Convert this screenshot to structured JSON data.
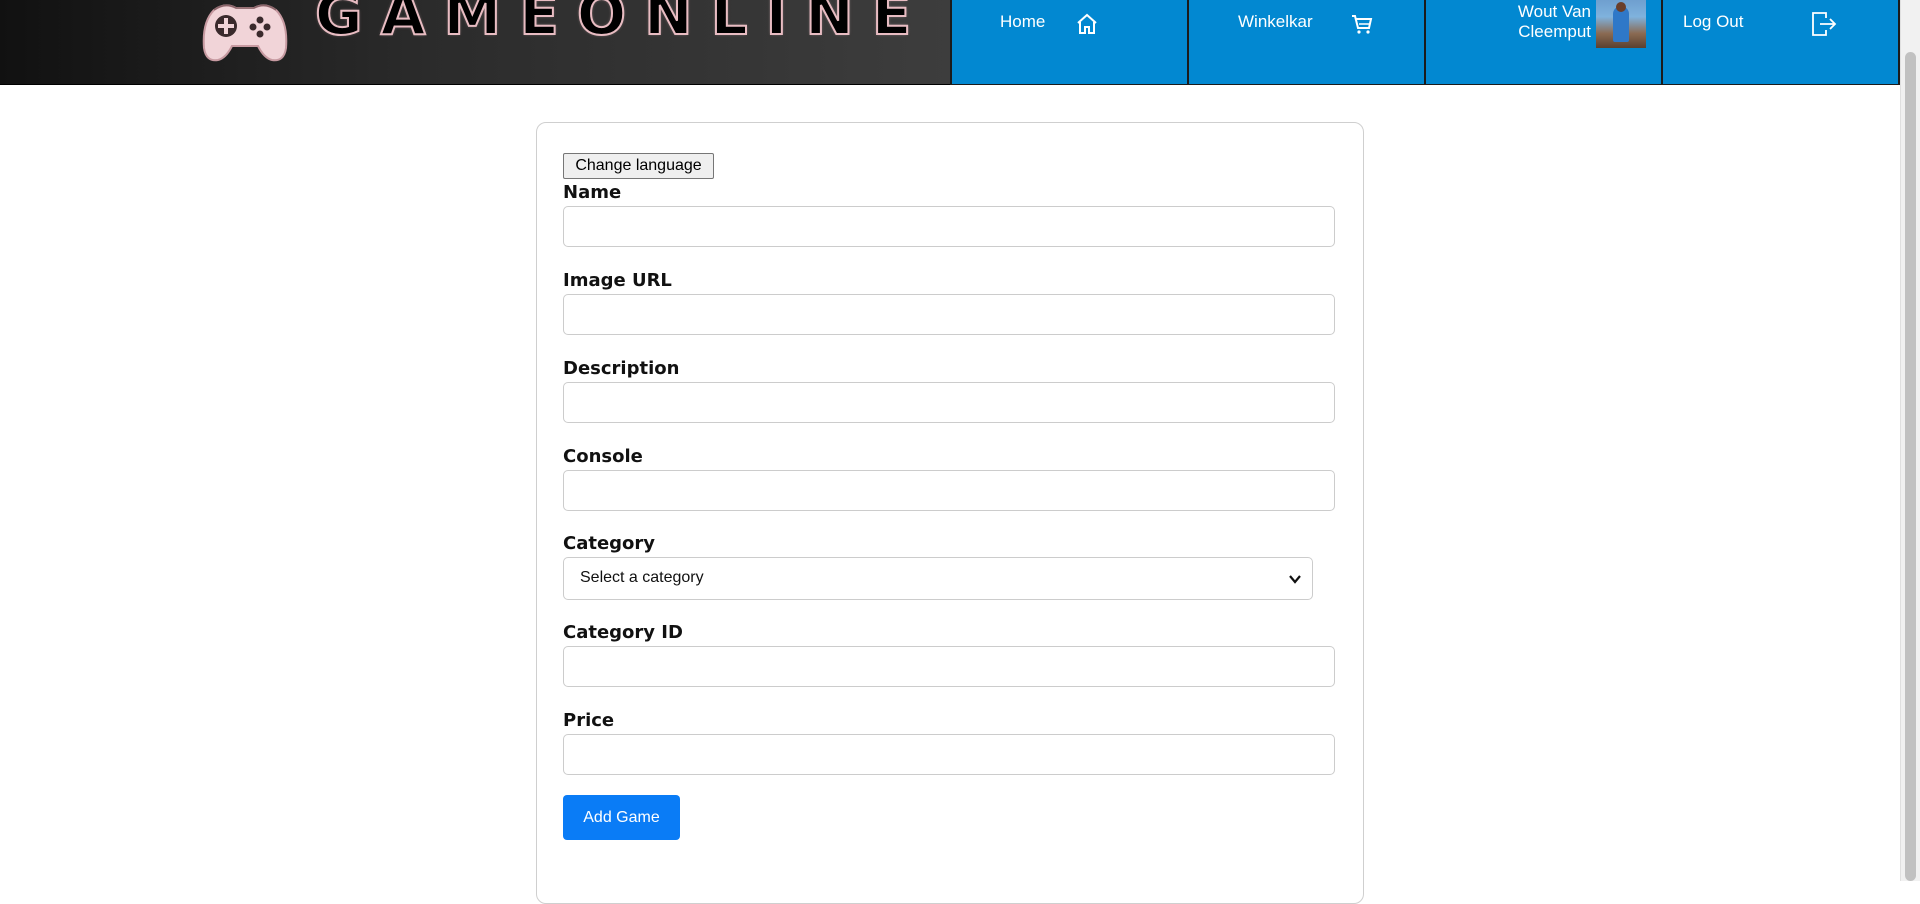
{
  "header": {
    "brand": "GAMEONLINE",
    "nav": {
      "home_label": "Home",
      "cart_label": "Winkelkar",
      "user_name_line1": "Wout Van",
      "user_name_line2": "Cleemput",
      "logout_label": "Log Out"
    },
    "nav_color": "#0288d1"
  },
  "form": {
    "change_language_label": "Change language",
    "fields": {
      "name_label": "Name",
      "image_url_label": "Image URL",
      "description_label": "Description",
      "console_label": "Console",
      "category_label": "Category",
      "category_selected": "Select a category",
      "category_id_label": "Category ID",
      "price_label": "Price"
    },
    "submit_label": "Add Game",
    "submit_color": "#0a7cf6"
  }
}
